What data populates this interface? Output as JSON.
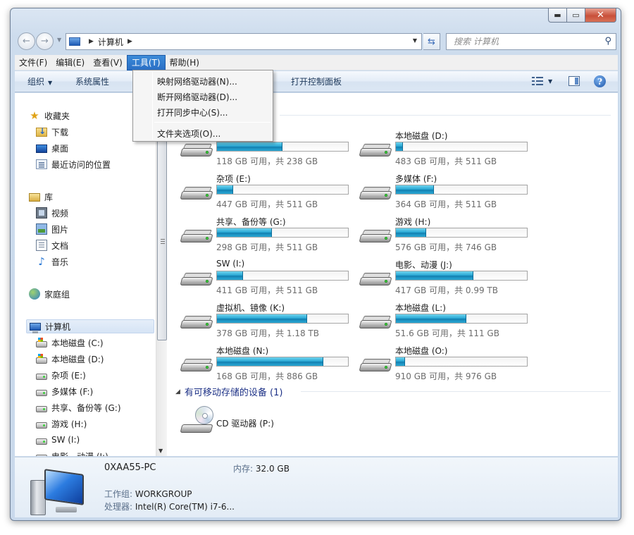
{
  "address": {
    "crumbs": [
      "计算机"
    ],
    "search_placeholder": "搜索 计算机"
  },
  "menubar": {
    "items": [
      "文件(F)",
      "编辑(E)",
      "查看(V)",
      "工具(T)",
      "帮助(H)"
    ],
    "active": "工具(T)"
  },
  "toolbar": {
    "organize": "组织",
    "system_properties": "系统属性",
    "open_control_panel": "打开控制面板"
  },
  "tools_menu": {
    "items": [
      "映射网络驱动器(N)...",
      "断开网络驱动器(D)...",
      "打开同步中心(S)...",
      "文件夹选项(O)..."
    ]
  },
  "sidebar": {
    "favorites": "收藏夹",
    "favorites_items": [
      "下载",
      "桌面",
      "最近访问的位置"
    ],
    "libraries": "库",
    "library_items": [
      "视频",
      "图片",
      "文档",
      "音乐"
    ],
    "homegroup": "家庭组",
    "computer": "计算机",
    "computer_items": [
      "本地磁盘 (C:)",
      "本地磁盘 (D:)",
      "杂项 (E:)",
      "多媒体 (F:)",
      "共享、备份等 (G:)",
      "游戏 (H:)",
      "SW (I:)",
      "电影、动漫 (J:)"
    ]
  },
  "drives": [
    {
      "name": "",
      "space": "118 GB 可用，共 238 GB",
      "used_fraction": 0.5
    },
    {
      "name": "本地磁盘 (D:)",
      "space": "483 GB 可用，共 511 GB",
      "used_fraction": 0.055
    },
    {
      "name": "杂项 (E:)",
      "space": "447 GB 可用，共 511 GB",
      "used_fraction": 0.125
    },
    {
      "name": "多媒体 (F:)",
      "space": "364 GB 可用，共 511 GB",
      "used_fraction": 0.29
    },
    {
      "name": "共享、备份等 (G:)",
      "space": "298 GB 可用，共 511 GB",
      "used_fraction": 0.42
    },
    {
      "name": "游戏 (H:)",
      "space": "576 GB 可用，共 746 GB",
      "used_fraction": 0.23
    },
    {
      "name": "SW (I:)",
      "space": "411 GB 可用，共 511 GB",
      "used_fraction": 0.2
    },
    {
      "name": "电影、动漫 (J:)",
      "space": "417 GB 可用，共 0.99 TB",
      "used_fraction": 0.59
    },
    {
      "name": "虚拟机、镜像 (K:)",
      "space": "378 GB 可用，共 1.18 TB",
      "used_fraction": 0.69
    },
    {
      "name": "本地磁盘 (L:)",
      "space": "51.6 GB 可用，共 111 GB",
      "used_fraction": 0.54
    },
    {
      "name": "本地磁盘 (N:)",
      "space": "168 GB 可用，共 886 GB",
      "used_fraction": 0.81
    },
    {
      "name": "本地磁盘 (O:)",
      "space": "910 GB 可用，共 976 GB",
      "used_fraction": 0.07
    }
  ],
  "removable": {
    "header": "有可移动存储的设备 (1)",
    "cd_name": "CD 驱动器 (P:)"
  },
  "details": {
    "pc_name": "0XAA55-PC",
    "memory_label": "内存:",
    "memory_value": "32.0 GB",
    "workgroup_label": "工作组:",
    "workgroup_value": "WORKGROUP",
    "processor_label": "处理器:",
    "processor_value": "Intel(R) Core(TM) i7-6..."
  }
}
